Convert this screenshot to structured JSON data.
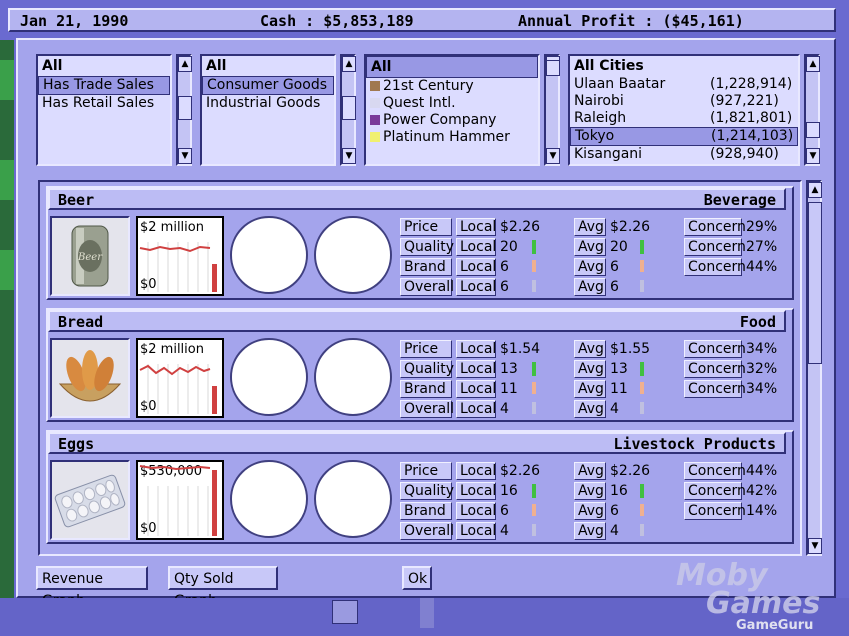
{
  "topbar": {
    "date": "Jan 21, 1990",
    "cash": "Cash : $5,853,189",
    "profit": "Annual Profit : ($45,161)"
  },
  "filters": {
    "list1": {
      "header": "All",
      "items": [
        "Has Trade Sales",
        "Has Retail Sales"
      ],
      "selected_index": 0
    },
    "list2": {
      "header": "All",
      "items": [
        "Consumer Goods",
        "Industrial Goods"
      ],
      "selected_index": 0
    },
    "list3": {
      "header": "All",
      "items": [
        {
          "label": "21st Century",
          "color": "#a07850"
        },
        {
          "label": "Quest Intl.",
          "color": "#d8d8f0"
        },
        {
          "label": "Power Company",
          "color": "#7a3a9a"
        },
        {
          "label": "Platinum Hammer",
          "color": "#f0f070"
        }
      ]
    },
    "cities": {
      "header": "All Cities",
      "items": [
        {
          "name": "Ulaan Baatar",
          "pop": "(1,228,914)"
        },
        {
          "name": "Nairobi",
          "pop": "(927,221)"
        },
        {
          "name": "Raleigh",
          "pop": "(1,821,801)"
        },
        {
          "name": "Tokyo",
          "pop": "(1,214,103)"
        },
        {
          "name": "Kisangani",
          "pop": "(928,940)"
        }
      ],
      "selected_index": 3
    }
  },
  "labels": {
    "price": "Price",
    "quality": "Quality",
    "brand": "Brand",
    "overall": "Overall",
    "local": "Local",
    "avg": "Avg",
    "concern": "Concern"
  },
  "products": [
    {
      "name": "Beer",
      "category": "Beverage",
      "image_label": "Beer",
      "graph_top": "$2 million",
      "graph_bottom": "$0",
      "price_local": "$2.26",
      "quality_local": "20",
      "brand_local": "6",
      "overall_local": "6",
      "price_avg": "$2.26",
      "quality_avg": "20",
      "brand_avg": "6",
      "overall_avg": "6",
      "concerns": [
        "29%",
        "27%",
        "44%"
      ]
    },
    {
      "name": "Bread",
      "category": "Food",
      "image_label": "",
      "graph_top": "$2 million",
      "graph_bottom": "$0",
      "price_local": "$1.54",
      "quality_local": "13",
      "brand_local": "11",
      "overall_local": "4",
      "price_avg": "$1.55",
      "quality_avg": "13",
      "brand_avg": "11",
      "overall_avg": "4",
      "concerns": [
        "34%",
        "32%",
        "34%"
      ]
    },
    {
      "name": "Eggs",
      "category": "Livestock Products",
      "image_label": "",
      "graph_top": "$530,000",
      "graph_bottom": "$0",
      "price_local": "$2.26",
      "quality_local": "16",
      "brand_local": "6",
      "overall_local": "4",
      "price_avg": "$2.26",
      "quality_avg": "16",
      "brand_avg": "6",
      "overall_avg": "4",
      "concerns": [
        "44%",
        "42%",
        "14%"
      ]
    }
  ],
  "footer": {
    "revenue_graph": "Revenue Graph",
    "qty_sold_graph": "Qty Sold Graph",
    "ok": "Ok"
  },
  "watermark": {
    "line1": "Moby",
    "line2": "Games",
    "line3": "GameGuru"
  },
  "colors": {
    "quality_bar": "#40c040",
    "brand_bar": "#f0b090",
    "overall_bar": "#c0c0e0",
    "graph_red": "#d04040"
  }
}
